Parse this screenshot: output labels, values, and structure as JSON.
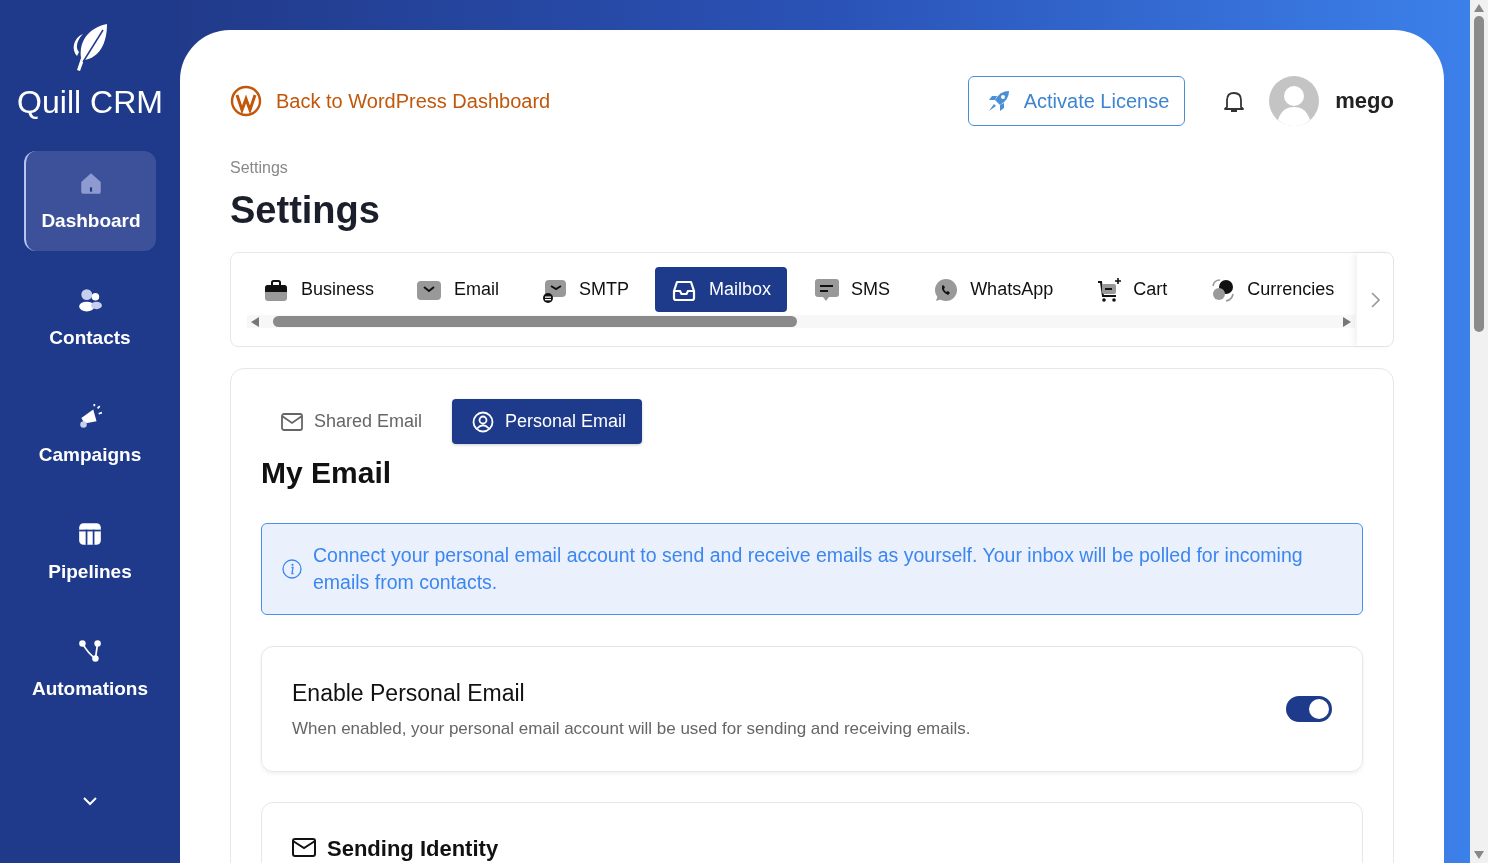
{
  "app": {
    "name": "Quill CRM"
  },
  "sidebar": {
    "items": [
      {
        "label": "Dashboard",
        "selected": true
      },
      {
        "label": "Contacts",
        "selected": false
      },
      {
        "label": "Campaigns",
        "selected": false
      },
      {
        "label": "Pipelines",
        "selected": false
      },
      {
        "label": "Automations",
        "selected": false
      }
    ]
  },
  "header": {
    "back_link": "Back to WordPress Dashboard",
    "license_button": "Activate License",
    "user": {
      "name": "mego"
    }
  },
  "breadcrumb": "Settings",
  "page_title": "Settings",
  "settings_tabs": [
    {
      "label": "Business",
      "selected": false
    },
    {
      "label": "Email",
      "selected": false
    },
    {
      "label": "SMTP",
      "selected": false
    },
    {
      "label": "Mailbox",
      "selected": true
    },
    {
      "label": "SMS",
      "selected": false
    },
    {
      "label": "WhatsApp",
      "selected": false
    },
    {
      "label": "Cart",
      "selected": false
    },
    {
      "label": "Currencies",
      "selected": false
    }
  ],
  "mailbox": {
    "sub_tabs": [
      {
        "label": "Shared Email",
        "selected": false
      },
      {
        "label": "Personal Email",
        "selected": true
      }
    ],
    "title": "My Email",
    "notice": "Connect your personal email account to send and receive emails as yourself. Your inbox will be polled for incoming emails from contacts.",
    "enable": {
      "title": "Enable Personal Email",
      "description": "When enabled, your personal email account will be used for sending and receiving emails.",
      "on": true
    },
    "section_title": "Sending Identity"
  }
}
